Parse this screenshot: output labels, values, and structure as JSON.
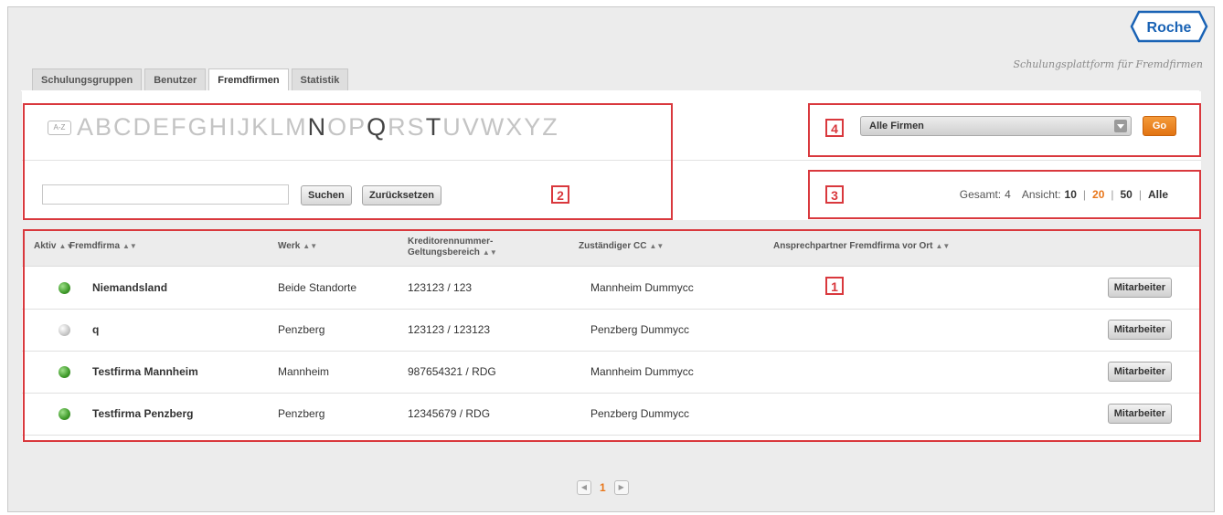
{
  "brand": {
    "logo_text": "Roche",
    "subtitle": "Schulungsplattform für Fremdfirmen",
    "logo_color": "#1a63b5"
  },
  "tabs": [
    {
      "label": "Schulungsgruppen",
      "active": false
    },
    {
      "label": "Benutzer",
      "active": false
    },
    {
      "label": "Fremdfirmen",
      "active": true
    },
    {
      "label": "Statistik",
      "active": false
    }
  ],
  "alphabet": {
    "az_label": "A-Z",
    "letters": [
      "A",
      "B",
      "C",
      "D",
      "E",
      "F",
      "G",
      "H",
      "I",
      "J",
      "K",
      "L",
      "M",
      "N",
      "O",
      "P",
      "Q",
      "R",
      "S",
      "T",
      "U",
      "V",
      "W",
      "X",
      "Y",
      "Z"
    ],
    "active_letters": [
      "N",
      "Q",
      "T"
    ]
  },
  "search": {
    "value": "",
    "search_label": "Suchen",
    "reset_label": "Zurücksetzen"
  },
  "filter": {
    "selected": "Alle Firmen",
    "go_label": "Go"
  },
  "paging_info": {
    "total_label": "Gesamt:",
    "total": "4",
    "view_label": "Ansicht:",
    "sizes": [
      "10",
      "20",
      "50",
      "Alle"
    ],
    "current_size": "20"
  },
  "annotations": [
    "1",
    "2",
    "3",
    "4"
  ],
  "table": {
    "headers": {
      "aktiv": "Aktiv",
      "fremdfirma": "Fremdfirma",
      "werk": "Werk",
      "kreditor_line1": "Kreditorennummer-",
      "kreditor_line2": "Geltungsbereich",
      "cc": "Zuständiger CC",
      "ansprech": "Ansprechpartner Fremdfirma vor Ort"
    },
    "rows": [
      {
        "active": true,
        "name": "Niemandsland",
        "werk": "Beide Standorte",
        "kreditor": "123123 / 123",
        "cc": "Mannheim Dummycc",
        "ansprech": "",
        "action": "Mitarbeiter"
      },
      {
        "active": false,
        "name": "q",
        "werk": "Penzberg",
        "kreditor": "123123 / 123123",
        "cc": "Penzberg Dummycc",
        "ansprech": "",
        "action": "Mitarbeiter"
      },
      {
        "active": true,
        "name": "Testfirma Mannheim",
        "werk": "Mannheim",
        "kreditor": "987654321 / RDG",
        "cc": "Mannheim Dummycc",
        "ansprech": "",
        "action": "Mitarbeiter"
      },
      {
        "active": true,
        "name": "Testfirma Penzberg",
        "werk": "Penzberg",
        "kreditor": "12345679 / RDG",
        "cc": "Penzberg Dummycc",
        "ansprech": "",
        "action": "Mitarbeiter"
      }
    ]
  },
  "pagination": {
    "current_page": "1"
  }
}
